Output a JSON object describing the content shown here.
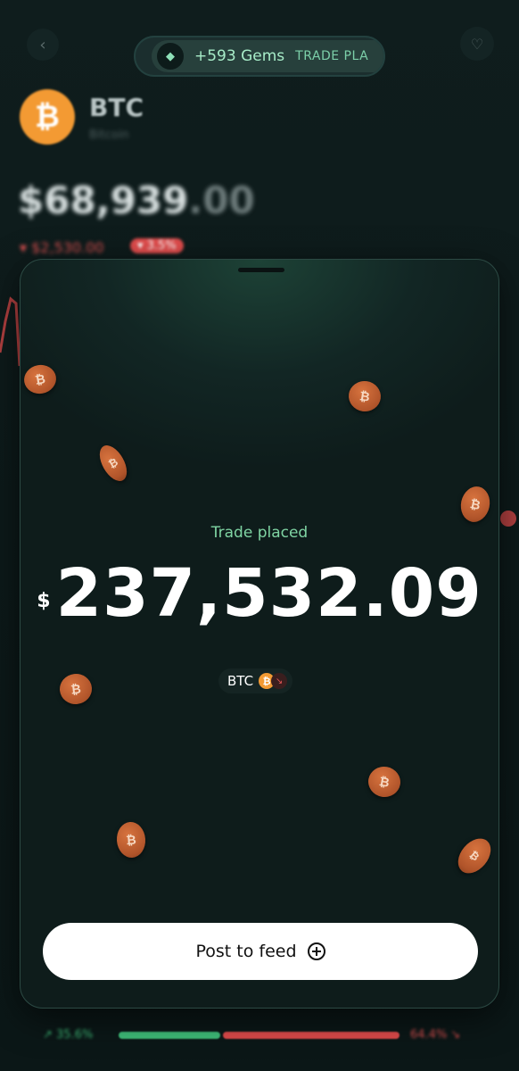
{
  "header": {
    "gems_label": "+593 Gems",
    "gems_trade_text": "TRADE PLA"
  },
  "coin": {
    "ticker": "BTC",
    "name": "Bitcoin",
    "logo_glyph": "₿",
    "price_main": "$68,939",
    "price_cents": ".00",
    "change_text": "▾ $2,530.00",
    "change_badge": "▾ 3.5%"
  },
  "sentiment": {
    "buy_pct": "↗ 35.6%",
    "sell_pct": "64.4% ↘",
    "buy_fraction": 0.356
  },
  "modal": {
    "status": "Trade placed",
    "currency_symbol": "$",
    "amount": "237,532.09",
    "asset_ticker": "BTC",
    "asset_glyph": "₿",
    "direction_glyph": "↘",
    "post_button_label": "Post to feed"
  },
  "icons": {
    "back": "chevron-left-icon",
    "favorite": "heart-icon",
    "gem": "gem-icon",
    "bitcoin": "bitcoin-icon",
    "plus": "plus-circle-icon"
  },
  "colors": {
    "accent_green": "#7fd4a3",
    "btc_orange": "#f39a33",
    "down_red": "#e24d4d",
    "sheet_bg": "#0e1c1b"
  }
}
